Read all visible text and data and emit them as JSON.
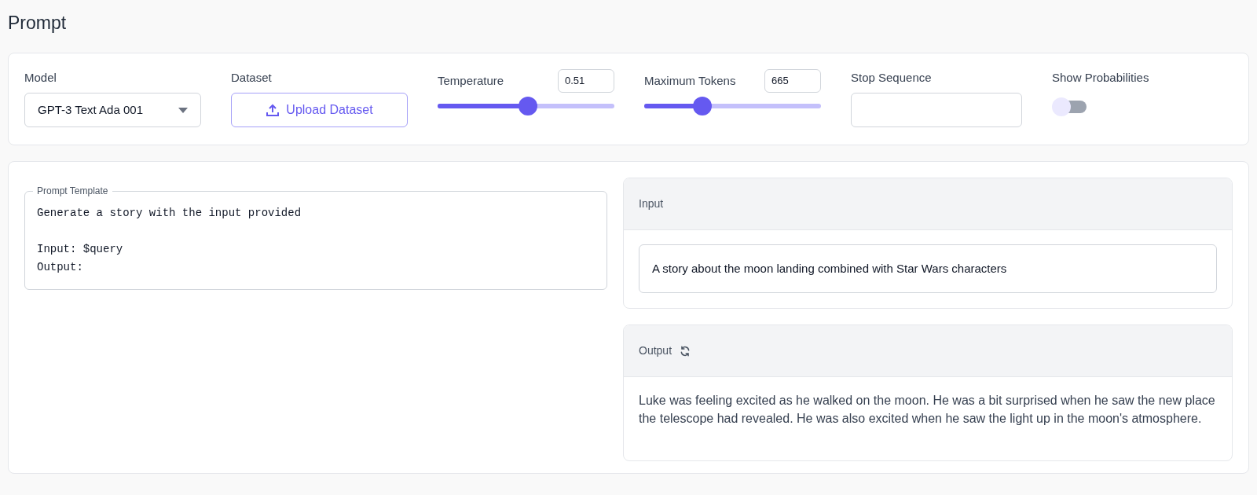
{
  "page_title": "Prompt",
  "settings": {
    "model": {
      "label": "Model",
      "value": "GPT-3 Text Ada 001"
    },
    "dataset": {
      "label": "Dataset",
      "button": "Upload Dataset"
    },
    "temperature": {
      "label": "Temperature",
      "value": "0.51",
      "level": 0.51
    },
    "max_tokens": {
      "label": "Maximum Tokens",
      "value": "665",
      "level": 0.33
    },
    "stop_sequence": {
      "label": "Stop Sequence"
    },
    "show_probabilities": {
      "label": "Show Probabilities",
      "on": false
    }
  },
  "prompt_template": {
    "legend": "Prompt Template",
    "text": "Generate a story with the input provided\n\nInput: $query\nOutput:"
  },
  "input": {
    "title": "Input",
    "value": "A story about the moon landing combined with Star Wars characters"
  },
  "output": {
    "title": "Output",
    "text": "Luke was feeling excited as he walked on the moon. He was a bit surprised when he saw the new place the telescope had revealed. He was also excited when he saw the light up in the moon's atmosphere."
  }
}
